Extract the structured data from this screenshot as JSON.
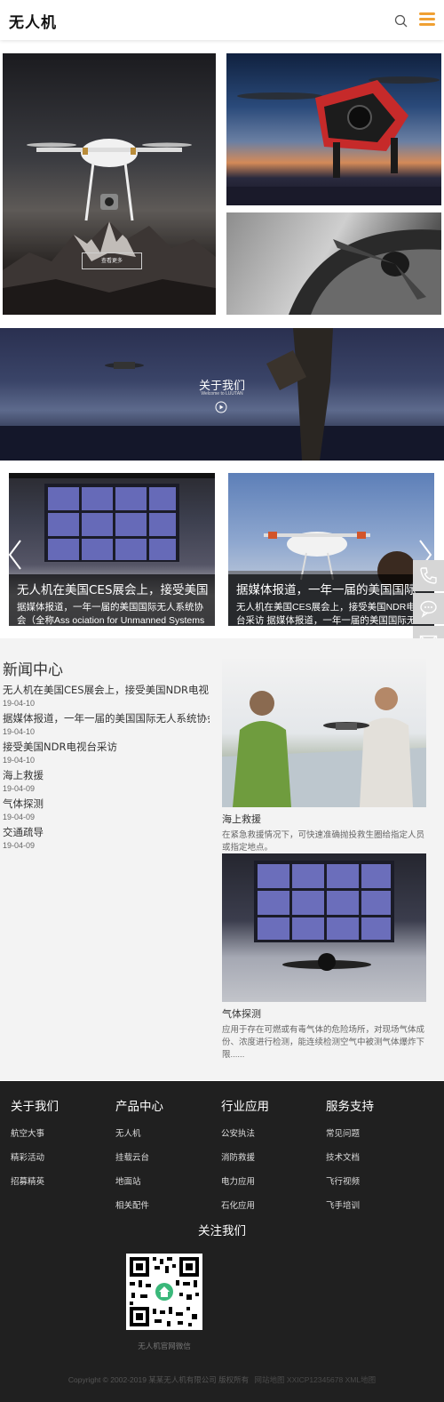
{
  "header": {
    "logo_text": "无人机",
    "search_icon": "search-icon",
    "menu_icon": "hamburger-menu-icon",
    "accent_color": "#f0a032"
  },
  "hero": {
    "more_button_label": "查看更多"
  },
  "about": {
    "title": "关于我们",
    "subtitle": "Welcome to LUUTAN",
    "play_icon": "play-icon"
  },
  "slider": {
    "slides": [
      {
        "title": "无人机在美国CES展会上，接受美国",
        "desc": "据媒体报道，一年一届的美国国际无人系统协会（全称Ass ociation for Unmanned Systems"
      },
      {
        "title": "据媒体报道，一年一届的美国国际",
        "desc": "无人机在美国CES展会上，接受美国NDR电视台采访 据媒体报道，一年一届的美国国际无人"
      }
    ],
    "prev_icon": "chevron-left-icon",
    "next_icon": "chevron-right-icon"
  },
  "side_tools": {
    "phone_icon": "phone-icon",
    "chat_icon": "chat-bubble-icon",
    "mail_icon": "mail-icon"
  },
  "news": {
    "title": "新闻中心",
    "items": [
      {
        "title": "无人机在美国CES展会上，接受美国NDR电视台采访",
        "date": "19-04-10"
      },
      {
        "title": "据媒体报道，一年一届的美国国际无人系统协会",
        "date": "19-04-10"
      },
      {
        "title": "接受美国NDR电视台采访",
        "date": "19-04-10"
      },
      {
        "title": "海上救援",
        "date": "19-04-09"
      },
      {
        "title": "气体探测",
        "date": "19-04-09"
      },
      {
        "title": "交通疏导",
        "date": "19-04-09"
      }
    ],
    "cards": [
      {
        "title": "海上救援",
        "desc": "在紧急救援情况下，可快速准确抛投救生圈给指定人员或指定地点。"
      },
      {
        "title": "气体探测",
        "desc": "应用于存在可燃或有毒气体的危险场所，对现场气体成份、浓度进行检测，能连续检测空气中被测气体爆炸下限......"
      }
    ]
  },
  "footer": {
    "columns": [
      {
        "title": "关于我们",
        "links": [
          "航空大事",
          "精彩活动",
          "招募精英"
        ]
      },
      {
        "title": "产品中心",
        "links": [
          "无人机",
          "挂载云台",
          "地面站",
          "相关配件"
        ]
      },
      {
        "title": "行业应用",
        "links": [
          "公安执法",
          "消防救援",
          "电力应用",
          "石化应用"
        ]
      },
      {
        "title": "服务支持",
        "links": [
          "常见问题",
          "技术文档",
          "飞行视频",
          "飞手培训"
        ]
      }
    ],
    "follow_title": "关注我们",
    "qr_caption": "无人机官网微信",
    "copyright": "Copyright © 2002-2019 某某无人机有限公司 版权所有",
    "icp": "网站地图  XXICP12345678  XML地图"
  }
}
